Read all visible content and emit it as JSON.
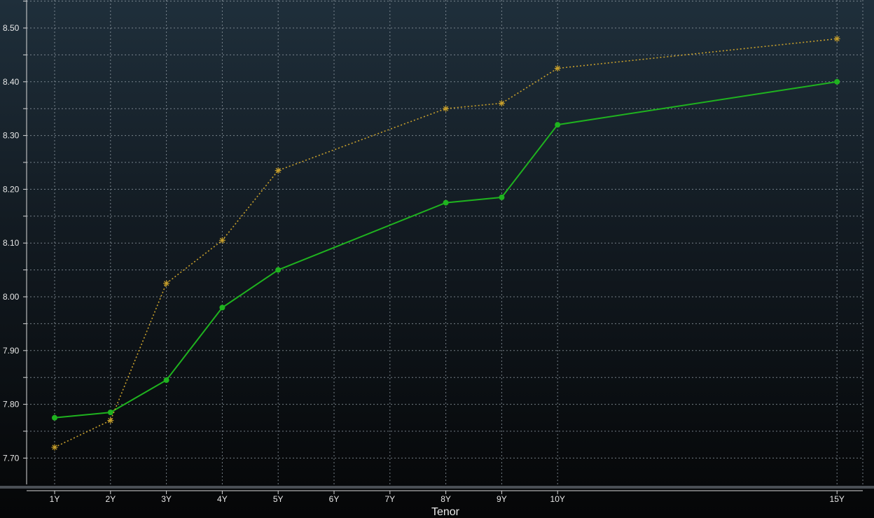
{
  "chart_data": {
    "type": "line",
    "xlabel": "Tenor",
    "ylabel": "",
    "title": "",
    "x_tenors_years": [
      1,
      2,
      3,
      4,
      5,
      6,
      7,
      8,
      9,
      10,
      15
    ],
    "x_tick_labels": [
      "1Y",
      "2Y",
      "3Y",
      "4Y",
      "5Y",
      "6Y",
      "7Y",
      "8Y",
      "9Y",
      "10Y",
      "15Y"
    ],
    "ylim": [
      7.65,
      8.55
    ],
    "y_ticks": [
      7.7,
      7.8,
      7.9,
      8.0,
      8.1,
      8.2,
      8.3,
      8.4,
      8.5
    ],
    "y_tick_labels": [
      "7.70",
      "7.80",
      "7.90",
      "8.00",
      "8.10",
      "8.20",
      "8.30",
      "8.40",
      "8.50"
    ],
    "grid": true,
    "series": [
      {
        "style": "solid",
        "marker": "circle",
        "color": "#1fb31f",
        "x": [
          1,
          2,
          3,
          4,
          5,
          8,
          9,
          10,
          15
        ],
        "values": [
          7.775,
          7.785,
          7.845,
          7.98,
          8.05,
          8.175,
          8.185,
          8.32,
          8.4
        ]
      },
      {
        "style": "dotted",
        "marker": "asterisk",
        "color": "#c8a02c",
        "x": [
          1,
          2,
          3,
          4,
          5,
          8,
          9,
          10,
          15
        ],
        "values": [
          7.72,
          7.77,
          8.025,
          8.105,
          8.235,
          8.35,
          8.36,
          8.425,
          8.48
        ]
      }
    ]
  },
  "colors": {
    "grid": "#8f9aa3",
    "axis": "#d8d8d8",
    "text": "#e8e8e8"
  }
}
